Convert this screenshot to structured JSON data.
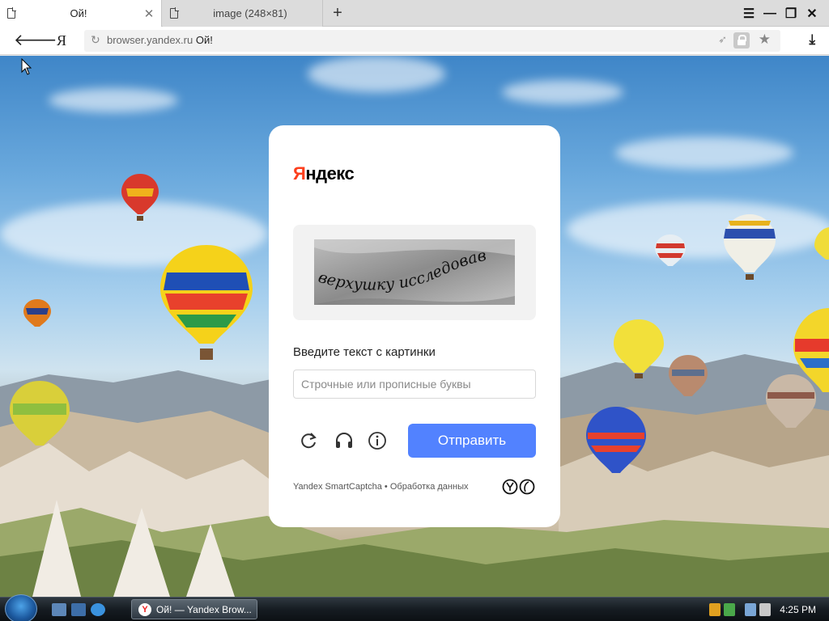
{
  "browser": {
    "tabs": [
      {
        "title": "Ой!",
        "active": true
      },
      {
        "title": "image (248×81)",
        "active": false
      }
    ],
    "new_tab": "+",
    "address": {
      "domain": "browser.yandex.ru",
      "page_title": "Ой!"
    },
    "ya_button": "Я"
  },
  "captcha": {
    "logo_first": "Я",
    "logo_rest": "ндекс",
    "image_text": "верхушку исследовав",
    "prompt": "Введите текст с картинки",
    "input_placeholder": "Строчные или прописные буквы",
    "input_value": "",
    "submit_label": "Отправить",
    "footer_brand": "Yandex SmartCaptcha",
    "footer_separator": "•",
    "footer_link": "Обработка данных",
    "icons": [
      "refresh-icon",
      "audio-icon",
      "info-icon"
    ]
  },
  "taskbar": {
    "active_window": "Ой! — Yandex Brow...",
    "clock": "4:25 PM"
  },
  "colors": {
    "submit": "#5282ff",
    "logo_accent": "#fc3f1d"
  }
}
